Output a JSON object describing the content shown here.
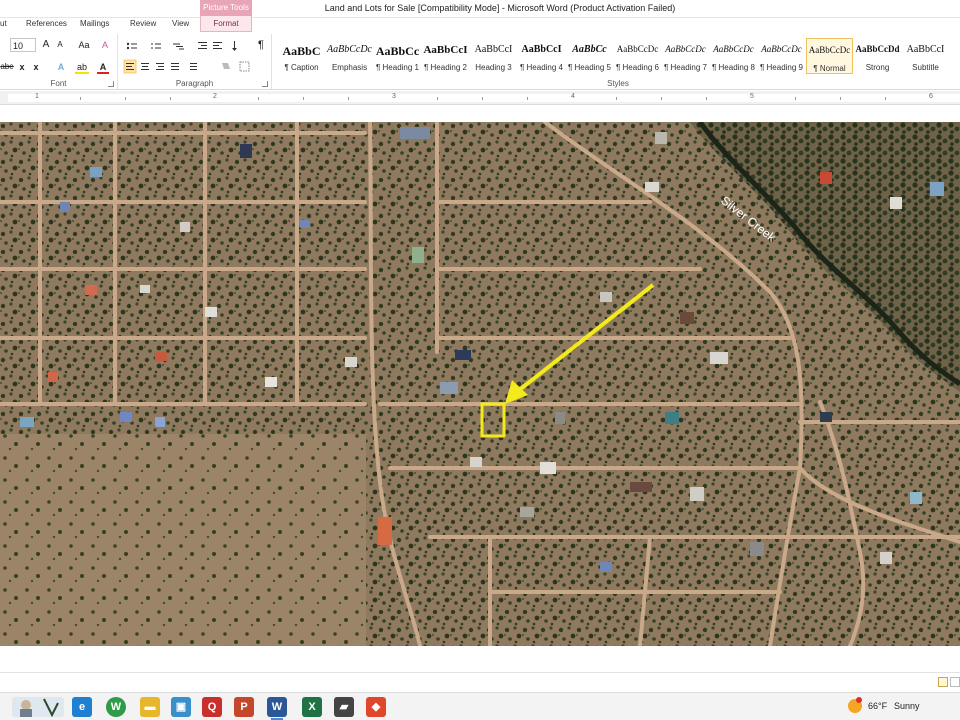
{
  "window": {
    "title": "Land and Lots for Sale [Compatibility Mode]  -  Microsoft Word (Product Activation Failed)",
    "context_tab_group": "Picture Tools"
  },
  "tabs": [
    {
      "label": "ut"
    },
    {
      "label": "References"
    },
    {
      "label": "Mailings"
    },
    {
      "label": "Review"
    },
    {
      "label": "View"
    },
    {
      "label": "Format"
    }
  ],
  "font_group": {
    "size": "10",
    "label": "Font",
    "grow": "A",
    "shrink": "A",
    "case": "Aa",
    "clear": "A",
    "strike": "abe",
    "subscript": "x",
    "superscript": "x",
    "text_effects": "A",
    "highlight": "ab",
    "font_color": "A",
    "highlight_color": "#f4e500",
    "font_color_value": "#e02020"
  },
  "paragraph_group": {
    "label": "Paragraph",
    "pilcrow": "¶"
  },
  "styles_group": {
    "label": "Styles",
    "items": [
      {
        "preview": "AaBbC",
        "name": "¶ Caption"
      },
      {
        "preview": "AaBbCcDc",
        "name": "Emphasis"
      },
      {
        "preview": "AaBbCc",
        "name": "¶ Heading 1"
      },
      {
        "preview": "AaBbCcI",
        "name": "¶ Heading 2"
      },
      {
        "preview": "AaBbCcI",
        "name": "Heading 3"
      },
      {
        "preview": "AaBbCcI",
        "name": "¶ Heading 4"
      },
      {
        "preview": "AaBbCc",
        "name": "¶ Heading 5"
      },
      {
        "preview": "AaBbCcDc",
        "name": "¶ Heading 6"
      },
      {
        "preview": "AaBbCcDc",
        "name": "¶ Heading 7"
      },
      {
        "preview": "AaBbCcDc",
        "name": "¶ Heading 8"
      },
      {
        "preview": "AaBbCcDc",
        "name": "¶ Heading 9"
      },
      {
        "preview": "AaBbCcDc",
        "name": "¶ Normal"
      },
      {
        "preview": "AaBbCcDd",
        "name": "Strong"
      },
      {
        "preview": "AaBbCcI",
        "name": "Subtitle"
      }
    ]
  },
  "ruler": {
    "numbers": [
      "1",
      "2",
      "3",
      "4",
      "5",
      "6"
    ]
  },
  "map": {
    "creek_label": "Silver Creek",
    "highlight_color": "#f2ea1a"
  },
  "taskbar": {
    "weather_temp": "66°F",
    "weather_condition": "Sunny",
    "apps": [
      {
        "name": "edge",
        "glyph": "e",
        "color": "#1f7fd1"
      },
      {
        "name": "chrome",
        "glyph": "W",
        "color": "#2f9b48"
      },
      {
        "name": "file-explorer",
        "glyph": "▬",
        "color": "#e7b62a"
      },
      {
        "name": "photos",
        "glyph": "▣",
        "color": "#3a8ec9"
      },
      {
        "name": "quicken",
        "glyph": "Q",
        "color": "#c9302c"
      },
      {
        "name": "powerpoint",
        "glyph": "P",
        "color": "#c4472b"
      },
      {
        "name": "word",
        "glyph": "W",
        "color": "#2b5797"
      },
      {
        "name": "excel",
        "glyph": "X",
        "color": "#1f7244"
      },
      {
        "name": "car-app",
        "glyph": "▰",
        "color": "#444444"
      },
      {
        "name": "brave",
        "glyph": "◆",
        "color": "#e0472a"
      }
    ]
  }
}
